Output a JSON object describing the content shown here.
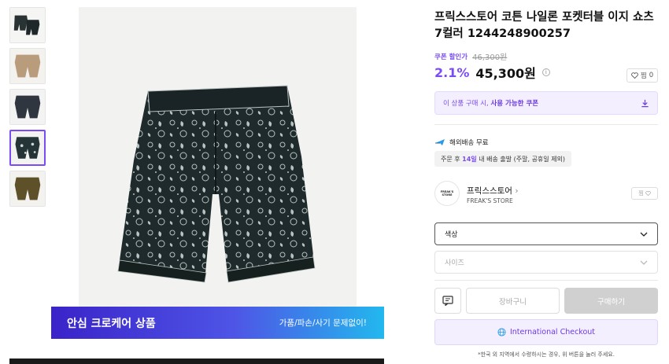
{
  "product": {
    "title": "프릭스스토어 코튼 나일론 포켓터블 이지 쇼츠 7컬러 1244248900257",
    "coupon_label": "쿠폰 할인가",
    "original_price": "46,300원",
    "discount_rate": "2.1%",
    "price": "45,300원",
    "wish_count": "0",
    "wish_label": "찜",
    "info_icon": "info-icon",
    "heart_icon": "heart-icon"
  },
  "coupon_box": {
    "text1": "이 상품 구매 시,",
    "text2": "사용 가능한 쿠폰",
    "icon": "download-icon"
  },
  "shipping": {
    "label": "해외배송 무료",
    "note_prefix": "주문 후",
    "note_days": "14일",
    "note_suffix": "내 배송 출발 (주말, 공휴일 제외)",
    "icon": "airplane-icon"
  },
  "store": {
    "name": "프릭스스토어",
    "sub": "FREAK'S STORE",
    "logo_text": "FREAK'S STORE",
    "fav_label": "찜"
  },
  "options": {
    "color_placeholder": "색상",
    "size_placeholder": "사이즈"
  },
  "actions": {
    "cart_label": "장바구니",
    "buy_label": "구매하기",
    "intl_label": "International Checkout",
    "footnote": "*한국 외 지역에서 수령하시는 경우, 위 버튼을 눌러 주세요."
  },
  "banner": {
    "title": "안심 크로케어 상품",
    "subtitle": "가품/파손/사기 문제없이!"
  },
  "colors": {
    "accent": "#7b4cf5",
    "banner_start": "#3a23c9",
    "banner_end": "#22b8ee"
  }
}
